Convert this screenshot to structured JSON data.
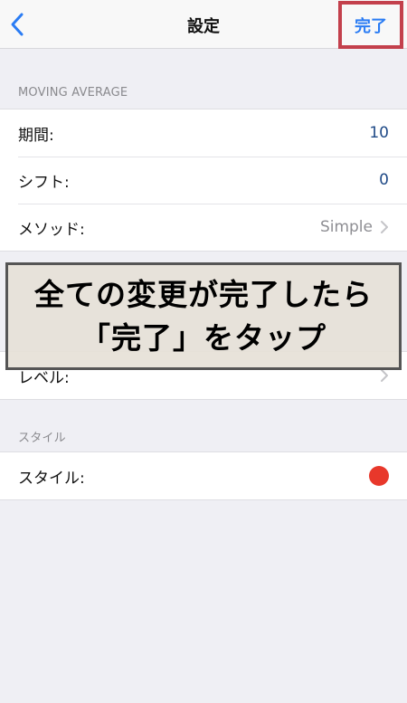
{
  "navbar": {
    "title": "設定",
    "done_label": "完了"
  },
  "sections": {
    "moving_average": {
      "header": "MOVING AVERAGE",
      "rows": [
        {
          "label": "期間:",
          "value": "10"
        },
        {
          "label": "シフト:",
          "value": "0"
        },
        {
          "label": "メソッド:",
          "value": "Simple"
        }
      ]
    },
    "level": {
      "rows": [
        {
          "label": "レベル:"
        }
      ]
    },
    "style": {
      "header": "スタイル",
      "rows": [
        {
          "label": "スタイル:",
          "color": "#e8382b"
        }
      ]
    }
  },
  "overlay": {
    "line1": "全ての変更が完了したら",
    "line2": "「完了」をタップ"
  },
  "colors": {
    "accent": "#2a7cf4",
    "highlight_border": "#c3404c",
    "value_text": "#1f4a87"
  }
}
